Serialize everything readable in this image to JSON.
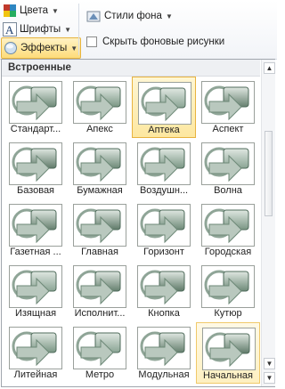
{
  "ribbon": {
    "colors_label": "Цвета",
    "fonts_label": "Шрифты",
    "effects_label": "Эффекты",
    "background_styles_label": "Стили фона",
    "hide_background_label": "Скрыть фоновые рисунки"
  },
  "gallery": {
    "section_title": "Встроенные",
    "selected": "Аптека",
    "highlighted": "Начальная",
    "items": [
      {
        "label": "Стандарт...",
        "icon": "effect-preview-icon"
      },
      {
        "label": "Апекс",
        "icon": "effect-preview-icon"
      },
      {
        "label": "Аптека",
        "icon": "effect-preview-icon"
      },
      {
        "label": "Аспект",
        "icon": "effect-preview-icon"
      },
      {
        "label": "Базовая",
        "icon": "effect-preview-icon"
      },
      {
        "label": "Бумажная",
        "icon": "effect-preview-icon"
      },
      {
        "label": "Воздушн...",
        "icon": "effect-preview-icon"
      },
      {
        "label": "Волна",
        "icon": "effect-preview-icon"
      },
      {
        "label": "Газетная ...",
        "icon": "effect-preview-icon"
      },
      {
        "label": "Главная",
        "icon": "effect-preview-icon"
      },
      {
        "label": "Горизонт",
        "icon": "effect-preview-icon"
      },
      {
        "label": "Городская",
        "icon": "effect-preview-icon"
      },
      {
        "label": "Изящная",
        "icon": "effect-preview-icon"
      },
      {
        "label": "Исполнит...",
        "icon": "effect-preview-icon"
      },
      {
        "label": "Кнопка",
        "icon": "effect-preview-icon"
      },
      {
        "label": "Кутюр",
        "icon": "effect-preview-icon"
      },
      {
        "label": "Литейная",
        "icon": "effect-preview-icon"
      },
      {
        "label": "Метро",
        "icon": "effect-preview-icon"
      },
      {
        "label": "Модульная",
        "icon": "effect-preview-icon"
      },
      {
        "label": "Начальная",
        "icon": "effect-preview-icon"
      }
    ]
  },
  "colors": {
    "accent_border": "#e8b340",
    "accent_fill": "#fde7a0",
    "shape_fill": "#6e8a78"
  }
}
